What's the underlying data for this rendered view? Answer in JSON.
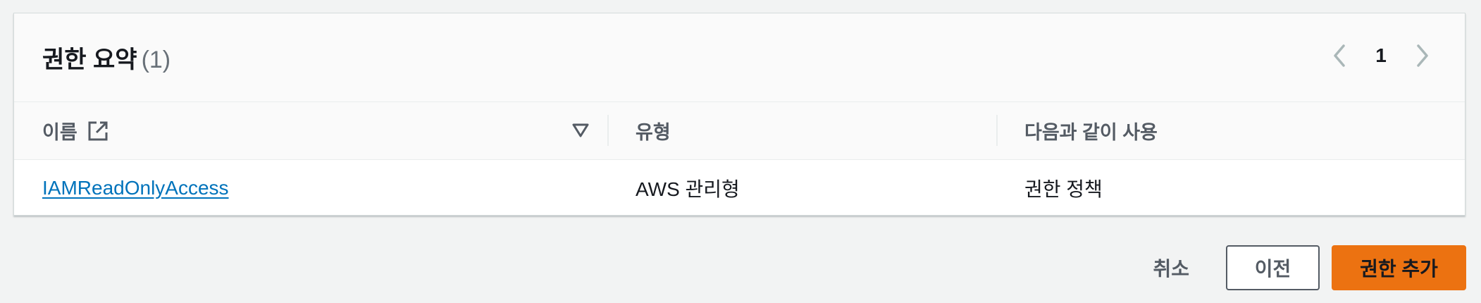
{
  "panel": {
    "title": "권한 요약",
    "count": "(1)"
  },
  "pagination": {
    "current_page": "1",
    "prev_icon": "chevron-left-icon",
    "next_icon": "chevron-right-icon"
  },
  "table": {
    "columns": [
      {
        "label": "이름",
        "icon": "external-link-icon"
      },
      {
        "label": "유형"
      },
      {
        "label": "다음과 같이 사용"
      }
    ],
    "sort_icon": "sort-descending-icon",
    "rows": [
      {
        "name": "IAMReadOnlyAccess",
        "type": "AWS 관리형",
        "used_as": "권한 정책"
      }
    ]
  },
  "actions": {
    "cancel_label": "취소",
    "previous_label": "이전",
    "primary_label": "권한 추가"
  },
  "colors": {
    "link": "#0073bb",
    "primary_button": "#ec7211",
    "page_background": "#f2f3f3"
  }
}
